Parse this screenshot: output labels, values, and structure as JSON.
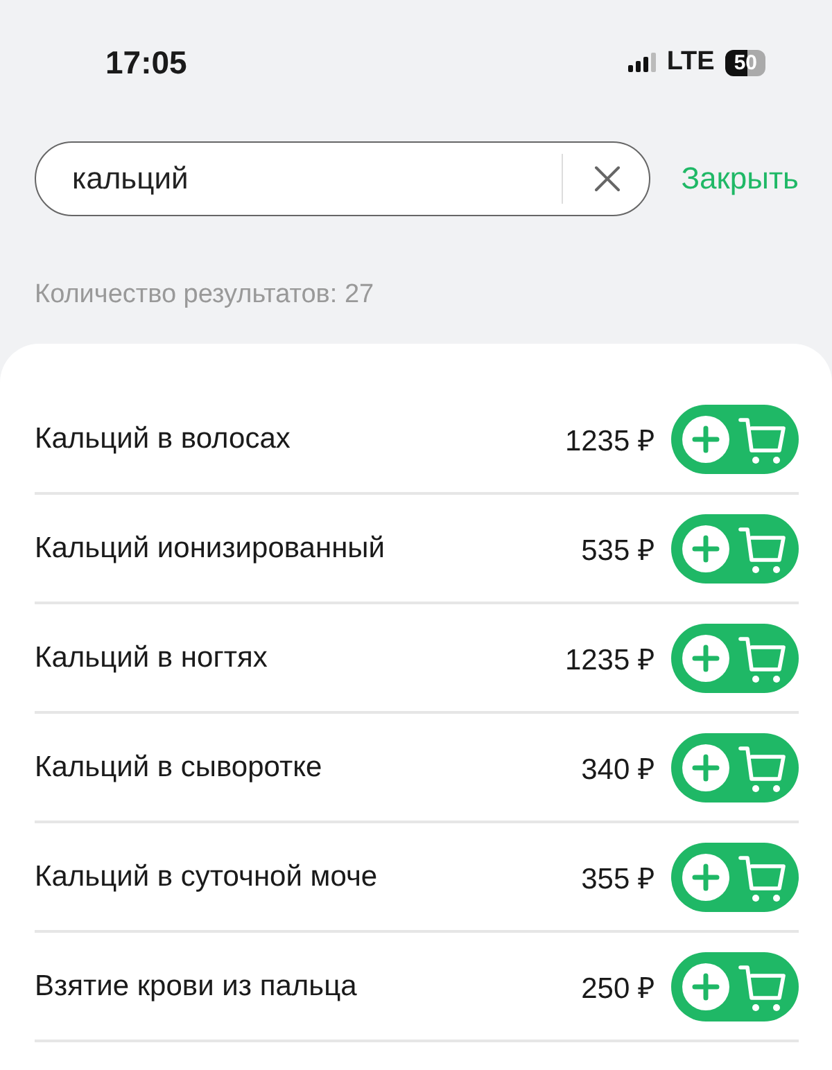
{
  "status_bar": {
    "time": "17:05",
    "network": "LTE",
    "battery": "50"
  },
  "search": {
    "value": "кальций",
    "close_label": "Закрыть"
  },
  "results_count": "Количество результатов: 27",
  "results": [
    {
      "name": "Кальций в волосах",
      "price": "1235 ₽"
    },
    {
      "name": "Кальций ионизированный",
      "price": "535 ₽"
    },
    {
      "name": "Кальций в ногтях",
      "price": "1235 ₽"
    },
    {
      "name": "Кальций в сыворотке",
      "price": "340 ₽"
    },
    {
      "name": "Кальций в суточной моче",
      "price": "355 ₽"
    },
    {
      "name": "Взятие крови из пальца",
      "price": "250 ₽"
    }
  ]
}
